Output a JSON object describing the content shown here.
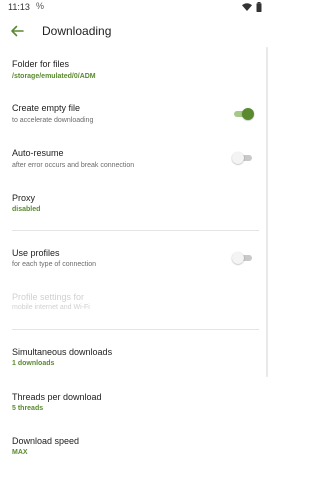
{
  "status_bar": {
    "time": "11:13",
    "notification_glyph": "%"
  },
  "toolbar": {
    "title": "Downloading"
  },
  "prefs": {
    "folder": {
      "title": "Folder for files",
      "summary": "/storage/emulated/0/ADM"
    },
    "empty_file": {
      "title": "Create empty file",
      "summary": "to accelerate downloading",
      "enabled": true
    },
    "auto_resume": {
      "title": "Auto-resume",
      "summary": "after error occurs and break connection",
      "enabled": false
    },
    "proxy": {
      "title": "Proxy",
      "summary": "disabled"
    },
    "use_profiles": {
      "title": "Use profiles",
      "summary": "for each type of connection",
      "enabled": false
    },
    "profile_settings": {
      "title": "Profile settings for",
      "summary": "mobile internet and Wi-Fi"
    },
    "simultaneous": {
      "title": "Simultaneous downloads",
      "summary": "1 downloads"
    },
    "threads": {
      "title": "Threads per download",
      "summary": "5 threads"
    },
    "speed": {
      "title": "Download speed",
      "summary": "MAX"
    }
  },
  "colors": {
    "accent": "#5a8a2f",
    "accent_track": "#a6c98a",
    "disabled_text": "#d0d0d0"
  }
}
